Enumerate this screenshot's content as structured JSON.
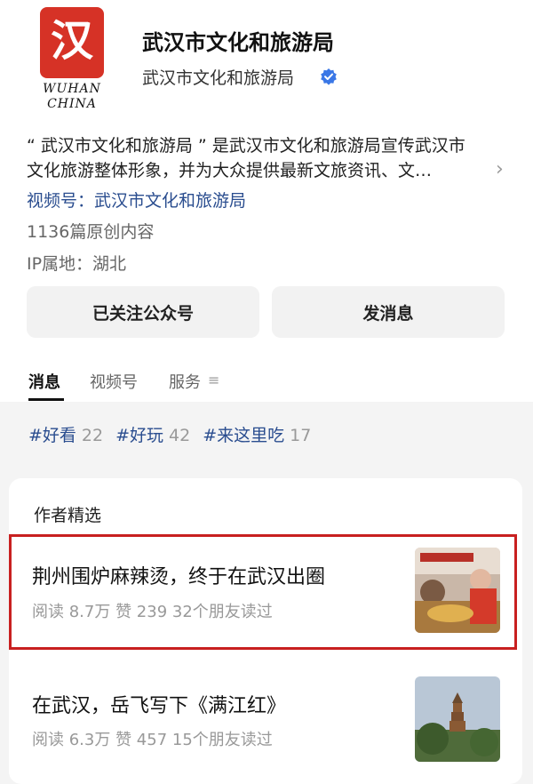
{
  "header": {
    "logo_glyph": "汉",
    "logo_line1": "WUHAN",
    "logo_line2": "CHINA",
    "account_title": "武汉市文化和旅游局",
    "account_subtitle": "武汉市文化和旅游局"
  },
  "description": {
    "line1": "“ 武汉市文化和旅游局 ” 是武汉市文化和旅游局宣传武汉市",
    "line2": "文化旅游整体形象，并为大众提供最新文旅资讯、文…"
  },
  "video_channel": {
    "prefix": "视频号：",
    "name": "武汉市文化和旅游局"
  },
  "stats": {
    "original_count": "1136篇原创内容",
    "ip_location": "IP属地：湖北"
  },
  "buttons": {
    "follow": "已关注公众号",
    "message": "发消息"
  },
  "tabs": {
    "messages": "消息",
    "video": "视频号",
    "service": "服务"
  },
  "tags": [
    {
      "name": "#好看",
      "count": "22"
    },
    {
      "name": "#好玩",
      "count": "42"
    },
    {
      "name": "#来这里吃",
      "count": "17"
    }
  ],
  "featured": {
    "title": "作者精选",
    "articles": [
      {
        "title": "荆州围炉麻辣烫，终于在武汉出圈",
        "meta": "阅读 8.7万  赞 239  32个朋友读过"
      },
      {
        "title": "在武汉，岳飞写下《满江红》",
        "meta": "阅读 6.3万  赞 457  15个朋友读过"
      }
    ]
  },
  "colors": {
    "brand_red": "#d63226",
    "link_blue": "#2a4d8f",
    "highlight_border": "#c82020"
  }
}
